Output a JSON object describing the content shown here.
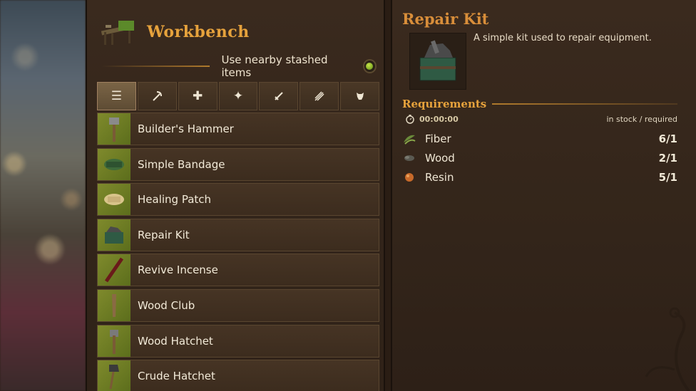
{
  "workbench": {
    "title": "Workbench",
    "stash_label": "Use nearby stashed items",
    "stash_enabled": true
  },
  "tabs": [
    {
      "icon": "list-icon",
      "glyph": "☰",
      "active": true
    },
    {
      "icon": "pickaxe-icon",
      "glyph": "⸝",
      "active": false
    },
    {
      "icon": "plus-icon",
      "glyph": "✚",
      "active": false
    },
    {
      "icon": "sparkle-icon",
      "glyph": "✦",
      "active": false
    },
    {
      "icon": "sword-icon",
      "glyph": "⚔",
      "active": false
    },
    {
      "icon": "arrows-icon",
      "glyph": "⫽",
      "active": false
    },
    {
      "icon": "armor-icon",
      "glyph": "♜",
      "active": false
    }
  ],
  "recipes": [
    {
      "label": "Builder's Hammer",
      "icon": "hammer-icon"
    },
    {
      "label": "Simple Bandage",
      "icon": "bandage-icon"
    },
    {
      "label": "Healing Patch",
      "icon": "patch-icon"
    },
    {
      "label": "Repair Kit",
      "icon": "repair-kit-icon"
    },
    {
      "label": "Revive Incense",
      "icon": "incense-icon"
    },
    {
      "label": "Wood Club",
      "icon": "club-icon"
    },
    {
      "label": "Wood Hatchet",
      "icon": "hatchet-icon"
    },
    {
      "label": "Crude Hatchet",
      "icon": "crude-hatchet-icon"
    }
  ],
  "detail": {
    "title": "Repair Kit",
    "description": "A simple kit used to repair equipment.",
    "requirements_title": "Requirements",
    "craft_time": "00:00:00",
    "stock_label": "in stock / required",
    "materials": [
      {
        "name": "Fiber",
        "count": "6/1",
        "icon": "fiber-icon"
      },
      {
        "name": "Wood",
        "count": "2/1",
        "icon": "wood-icon"
      },
      {
        "name": "Resin",
        "count": "5/1",
        "icon": "resin-icon"
      }
    ]
  },
  "colors": {
    "accent": "#e6a23c",
    "title_right": "#d88e3a",
    "toggle_on": "#8cc02a"
  }
}
